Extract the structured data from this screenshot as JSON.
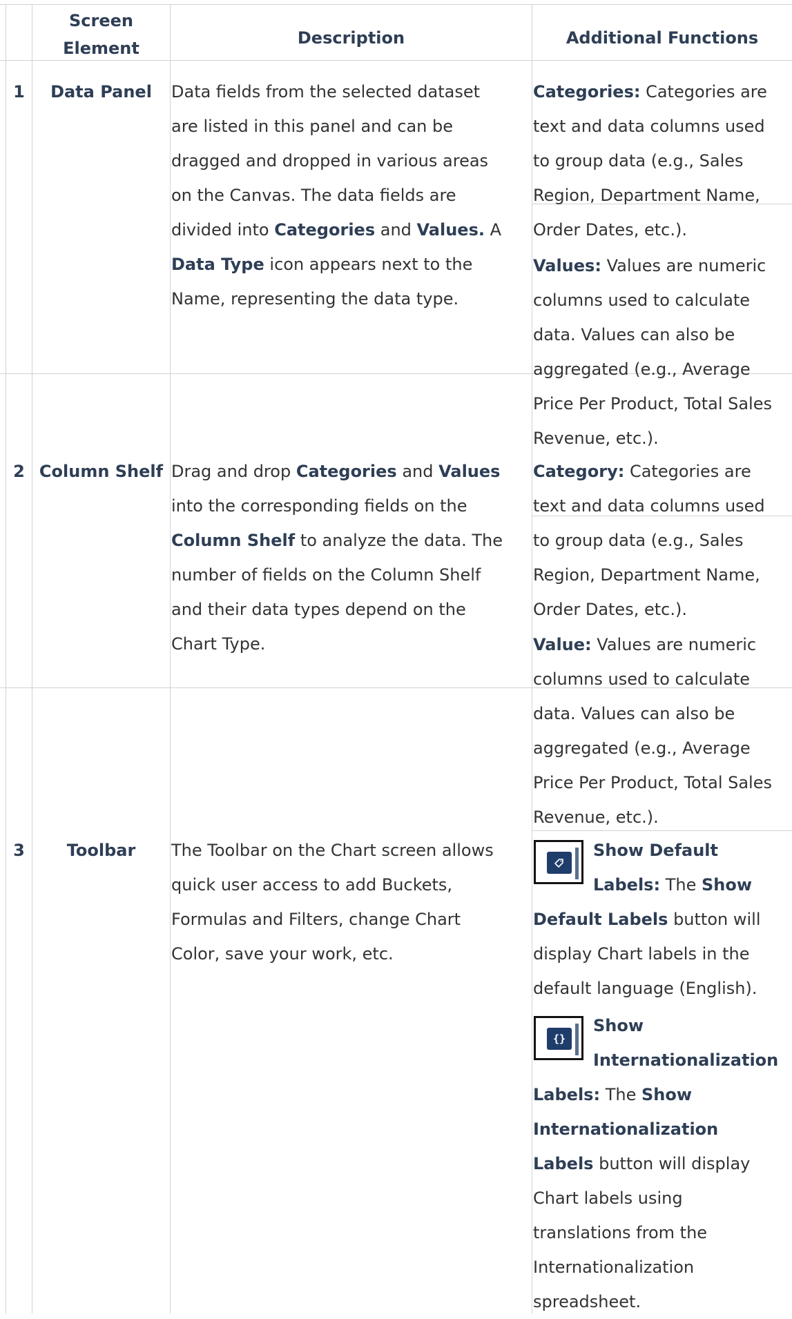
{
  "headers": {
    "screen_element": "Screen Element",
    "screen_element_line1": "Screen",
    "screen_element_line2": "Element",
    "description": "Description",
    "additional_functions": "Additional Functions"
  },
  "rows": [
    {
      "number": "1",
      "element": "Data Panel",
      "description": {
        "l1": "Data fields from the selected dataset",
        "l2": "are listed in this panel and can be",
        "l3": "dragged and dropped in various areas",
        "l4": "on the Canvas. The data fields are",
        "l5_a": "divided into ",
        "l5_b1": "Categories",
        "l5_c": " and ",
        "l5_b2": "Values.",
        "l5_d": " A",
        "l6_b": "Data Type",
        "l6_c": " icon appears next to the",
        "l7": "Name, representing the data type."
      },
      "functions": [
        {
          "label": "Categories:",
          "l1": " Categories are",
          "l2": "text and data columns used",
          "l3": "to group data (e.g., Sales",
          "l4": "Region, Department Name,",
          "l5": "Order Dates, etc.)."
        },
        {
          "label": "Values:",
          "l1": " Values are numeric",
          "l2": "columns used to calculate",
          "l3": "data. Values can also be",
          "l4": "aggregated (e.g., Average",
          "l5": "Price Per Product, Total Sales",
          "l6": "Revenue, etc.)."
        }
      ]
    },
    {
      "number": "2",
      "element": "Column Shelf",
      "description": {
        "l1_a": "Drag and drop ",
        "l1_b1": "Categories",
        "l1_c": " and ",
        "l1_b2": "Values",
        "l2": "into the corresponding fields on the",
        "l3_b": "Column Shelf",
        "l3_c": " to analyze the data. The",
        "l4": "number of fields on the Column Shelf",
        "l5": "and their data types depend on the",
        "l6": "Chart Type."
      },
      "functions": [
        {
          "label": "Category:",
          "l1": " Categories are",
          "l2": "text and data columns used",
          "l3": "to group data (e.g., Sales",
          "l4": "Region, Department Name,",
          "l5": "Order Dates, etc.)."
        },
        {
          "label": "Value:",
          "l1": " Values are numeric",
          "l2": "columns used to calculate",
          "l3": "data. Values can also be",
          "l4": "aggregated (e.g., Average",
          "l5": "Price Per Product, Total Sales",
          "l6": "Revenue, etc.)."
        }
      ]
    },
    {
      "number": "3",
      "element": "Toolbar",
      "description": {
        "l1": "The Toolbar on the Chart screen allows",
        "l2": "quick user access to add Buckets,",
        "l3": "Formulas and Filters, change Chart",
        "l4": "Color, save your work, etc."
      },
      "functions": [
        {
          "icon": "tag-icon",
          "t1": "Show Default",
          "t2": "Labels:",
          "t2_c": " The ",
          "t2_b": "Show",
          "l3_b": "Default Labels",
          "l3_c": " button will",
          "l4": "display Chart labels in the",
          "l5": "default language (English)."
        },
        {
          "icon": "braces-icon",
          "t1": "Show",
          "t2": "Internationalization",
          "l3_b": "Labels:",
          "l3_c": " The ",
          "l3_b2": "Show",
          "l4_b": "Internationalization",
          "l5_b": "Labels",
          "l5_c": " button will display",
          "l6": "Chart labels using",
          "l7": "translations from the",
          "l8": "Internationalization",
          "l9": "spreadsheet."
        }
      ]
    }
  ]
}
